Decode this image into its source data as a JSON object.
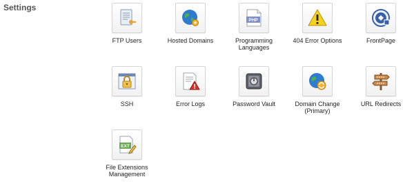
{
  "section": {
    "title": "Settings"
  },
  "items": [
    {
      "label": "FTP Users",
      "icon": "ftp-users-icon"
    },
    {
      "label": "Hosted Domains",
      "icon": "hosted-domains-icon"
    },
    {
      "label": "Programming Languages",
      "icon": "programming-languages-icon",
      "badge": "PHP"
    },
    {
      "label": "404 Error Options",
      "icon": "warning-icon"
    },
    {
      "label": "FrontPage",
      "icon": "frontpage-icon"
    },
    {
      "label": "SSH",
      "icon": "ssh-lock-icon"
    },
    {
      "label": "Error Logs",
      "icon": "error-logs-icon"
    },
    {
      "label": "Password Vault",
      "icon": "password-vault-icon"
    },
    {
      "label": "Domain Change (Primary)",
      "icon": "domain-change-icon"
    },
    {
      "label": "URL Redirects",
      "icon": "url-redirects-signpost-icon"
    },
    {
      "label": "File Extensions Management",
      "icon": "file-extensions-icon",
      "badge": "EXT"
    }
  ]
}
